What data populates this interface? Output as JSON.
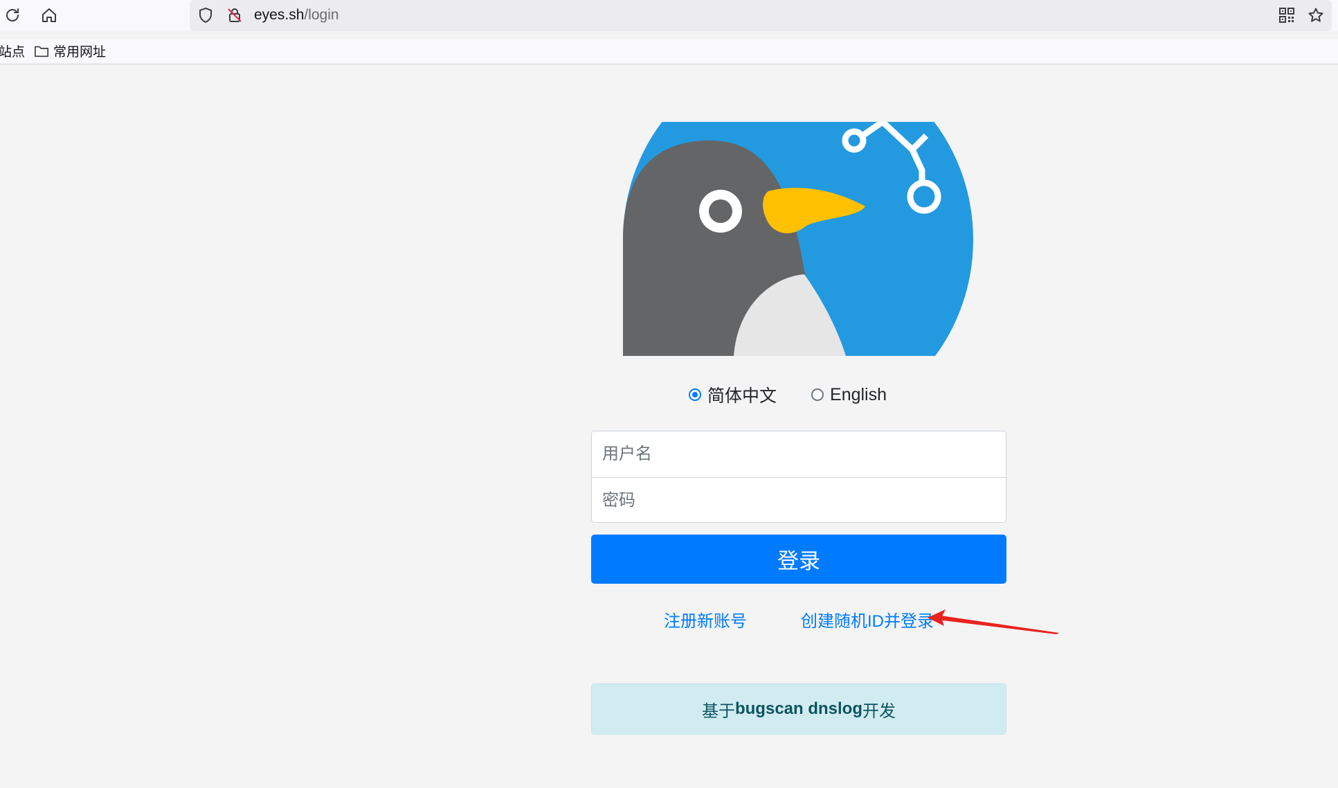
{
  "browser": {
    "url_host": "eyes.sh",
    "url_path": "/login",
    "bookmarks": [
      {
        "label": "站点",
        "icon": "none"
      },
      {
        "label": "常用网址",
        "icon": "folder-icon"
      }
    ]
  },
  "logo": {
    "alt": "penguin-logo"
  },
  "language": {
    "options": [
      {
        "label": "简体中文",
        "checked": true
      },
      {
        "label": "English",
        "checked": false
      }
    ]
  },
  "form": {
    "username_placeholder": "用户名",
    "password_placeholder": "密码",
    "login_label": "登录"
  },
  "links": {
    "register": "注册新账号",
    "random_id": "创建随机ID并登录"
  },
  "footer": {
    "prefix": "基于",
    "bold": "bugscan dnslog",
    "suffix": "开发"
  },
  "colors": {
    "primary": "#007bff",
    "annotation_arrow": "#e8231f",
    "info_bg": "#d1ecf1",
    "logo_blue": "#239ae0",
    "penguin_gray": "#646567",
    "beak_yellow": "#ffc000"
  }
}
